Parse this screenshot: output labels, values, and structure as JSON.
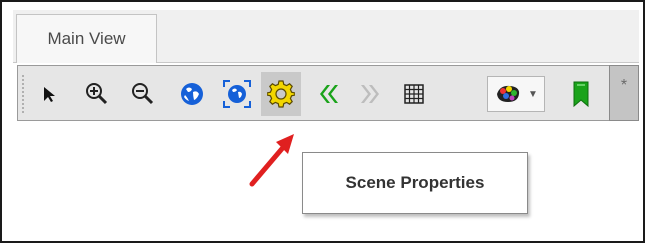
{
  "window": {
    "tabs": [
      {
        "label": "Main View",
        "active": true
      }
    ]
  },
  "toolbar": {
    "buttons": [
      {
        "icon": "pointer-select-icon",
        "tooltip": ""
      },
      {
        "icon": "zoom-in-icon",
        "tooltip": ""
      },
      {
        "icon": "zoom-out-icon",
        "tooltip": ""
      },
      {
        "icon": "globe-icon",
        "tooltip": ""
      },
      {
        "icon": "globe-extent-icon",
        "tooltip": ""
      },
      {
        "icon": "gear-icon",
        "tooltip": "Scene Properties",
        "hovered": true
      },
      {
        "icon": "double-chevron-left-icon",
        "tooltip": ""
      },
      {
        "icon": "double-chevron-right-icon",
        "tooltip": ""
      },
      {
        "icon": "grid-icon",
        "tooltip": ""
      },
      {
        "icon": "color-palette-dropdown-icon",
        "tooltip": ""
      },
      {
        "icon": "green-bookmark-icon",
        "tooltip": ""
      }
    ],
    "overflow_label": "*"
  },
  "tooltip": {
    "text": "Scene Properties"
  },
  "annotation": {
    "type": "red-arrow",
    "color": "#e02020"
  },
  "colors": {
    "blue_icon": "#1560d8",
    "gear_fill": "#f2d600",
    "chevron_green": "#1aa31a",
    "chevron_gray": "#bdbdbd",
    "active_button_bg": "#c9c9c9"
  }
}
